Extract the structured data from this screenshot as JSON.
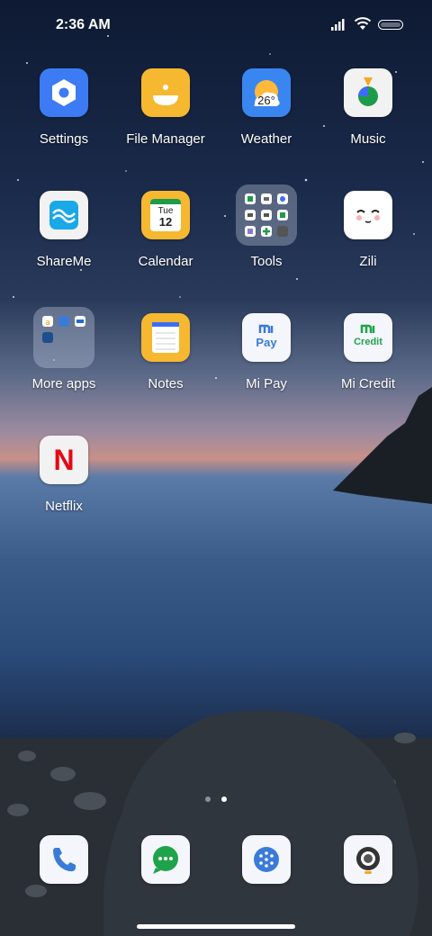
{
  "status_bar": {
    "time": "2:36 AM"
  },
  "apps": [
    {
      "name": "Settings"
    },
    {
      "name": "File Manager"
    },
    {
      "name": "Weather",
      "temperature": "26°"
    },
    {
      "name": "Music"
    },
    {
      "name": "ShareMe"
    },
    {
      "name": "Calendar",
      "day": "Tue",
      "date": "12"
    },
    {
      "name": "Tools"
    },
    {
      "name": "Zili"
    },
    {
      "name": "More apps"
    },
    {
      "name": "Notes"
    },
    {
      "name": "Mi Pay",
      "logo_text": "Pay"
    },
    {
      "name": "Mi Credit",
      "logo_text": "Credit"
    },
    {
      "name": "Netflix",
      "logo_text": "N"
    }
  ],
  "dock": [
    {
      "icon": "phone-icon"
    },
    {
      "icon": "messaging-icon"
    },
    {
      "icon": "browser-icon"
    },
    {
      "icon": "camera-icon"
    }
  ],
  "page_indicator": {
    "pages": 2,
    "current": 2
  },
  "colors": {
    "settings": "#3d7bf5",
    "file_manager": "#f6b830",
    "weather": "#3a86f0",
    "notes": "#f6b830",
    "mi_credit": "#1fa34a",
    "netflix": "#e50914"
  }
}
